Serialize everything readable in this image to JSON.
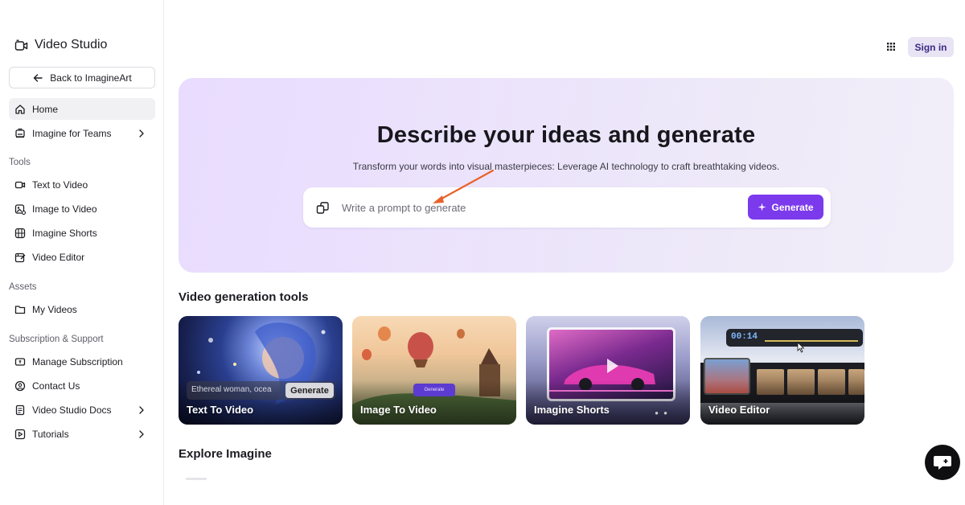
{
  "app": {
    "title": "Video Studio"
  },
  "sidebar": {
    "back_label": "Back to ImagineArt",
    "main": [
      {
        "label": "Home",
        "icon": "home-icon",
        "active": true
      },
      {
        "label": "Imagine for Teams",
        "icon": "teams-icon",
        "chevron": true
      }
    ],
    "sections": {
      "tools": "Tools",
      "assets": "Assets",
      "support": "Subscription & Support"
    },
    "tools": [
      {
        "label": "Text to Video",
        "icon": "text-video-icon"
      },
      {
        "label": "Image to Video",
        "icon": "image-video-icon"
      },
      {
        "label": "Imagine Shorts",
        "icon": "shorts-icon"
      },
      {
        "label": "Video Editor",
        "icon": "video-editor-icon"
      }
    ],
    "assets": [
      {
        "label": "My Videos",
        "icon": "folder-icon"
      }
    ],
    "support": [
      {
        "label": "Manage Subscription",
        "icon": "subscription-icon"
      },
      {
        "label": "Contact Us",
        "icon": "contact-icon"
      },
      {
        "label": "Video Studio Docs",
        "icon": "docs-icon",
        "chevron": true
      },
      {
        "label": "Tutorials",
        "icon": "tutorials-icon",
        "chevron": true
      }
    ]
  },
  "header": {
    "signin_label": "Sign in"
  },
  "hero": {
    "title": "Describe your ideas and generate",
    "subtitle": "Transform your words into visual masterpieces: Leverage AI technology to craft breathtaking videos.",
    "prompt_placeholder": "Write a prompt to generate",
    "generate_label": "Generate"
  },
  "tools_section": {
    "heading": "Video generation tools",
    "cards": [
      {
        "label": "Text To Video",
        "demo_text": "Ethereal woman, ocea",
        "demo_button": "Generate"
      },
      {
        "label": "Image To Video",
        "demo_button": "Generate"
      },
      {
        "label": "Imagine Shorts"
      },
      {
        "label": "Video Editor",
        "demo_time": "00:14"
      }
    ]
  },
  "explore_section": {
    "heading": "Explore Imagine"
  },
  "colors": {
    "accent": "#7c3aed",
    "signin_bg": "#e8e4f4",
    "hero_bg": "#ece4fb",
    "annotation_arrow": "#e8632b"
  }
}
